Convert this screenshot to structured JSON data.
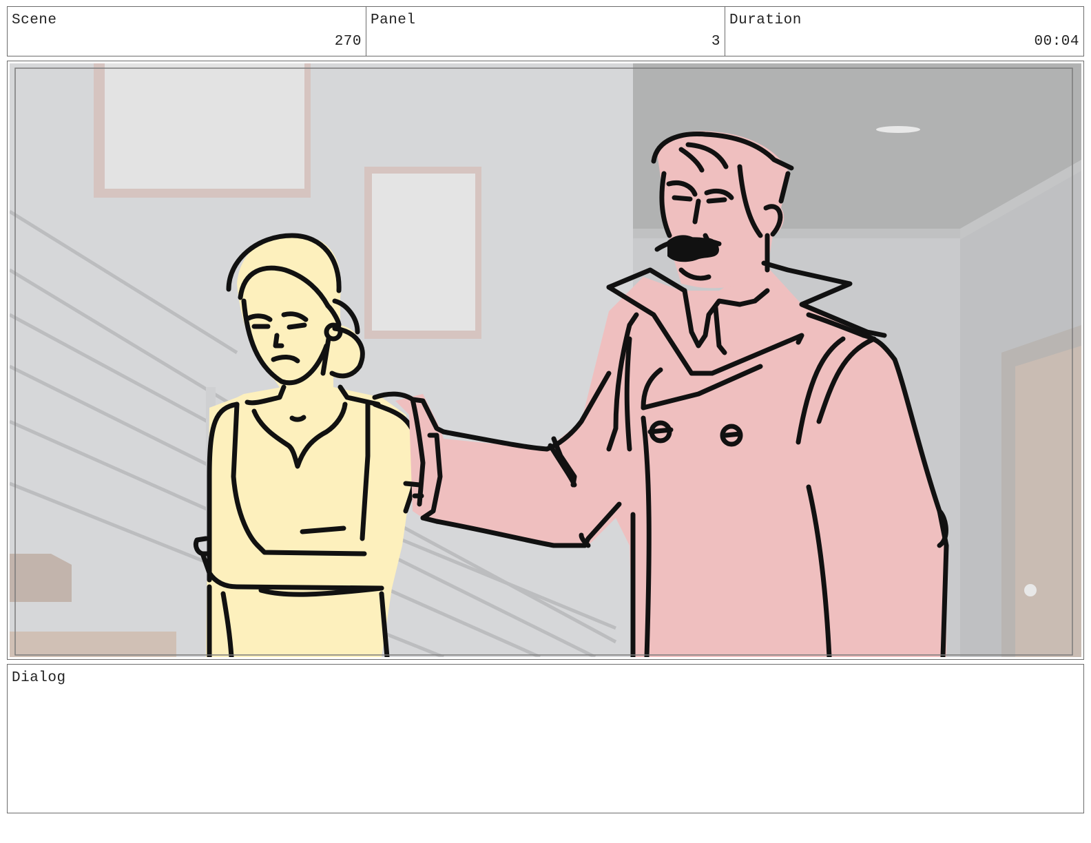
{
  "header": {
    "scene": {
      "label": "Scene",
      "value": "270"
    },
    "panel": {
      "label": "Panel",
      "value": "3"
    },
    "duration": {
      "label": "Duration",
      "value": "00:04"
    }
  },
  "dialog": {
    "label": "Dialog",
    "text": ""
  },
  "artwork": {
    "colors": {
      "wall": "#d6d7d9",
      "ceiling": "#b1b2b2",
      "woman_fill": "#fdf0bd",
      "man_fill": "#efbfbf",
      "ink": "#111111"
    }
  }
}
